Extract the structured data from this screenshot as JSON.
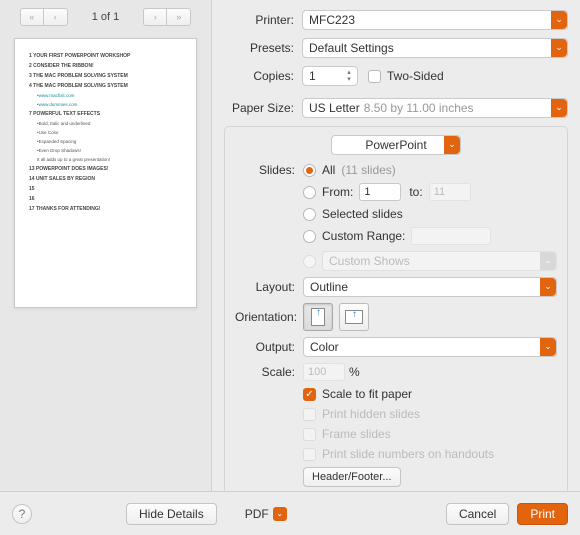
{
  "pager": {
    "label": "1 of 1"
  },
  "printer": {
    "label": "Printer:",
    "value": "MFC223"
  },
  "presets": {
    "label": "Presets:",
    "value": "Default Settings"
  },
  "copies": {
    "label": "Copies:",
    "value": "1",
    "two_sided_label": "Two-Sided"
  },
  "paper": {
    "label": "Paper Size:",
    "value": "US Letter",
    "dim": "8.50 by 11.00 inches"
  },
  "app": {
    "name": "PowerPoint"
  },
  "slides": {
    "label": "Slides:",
    "all": "All",
    "all_count": "(11 slides)",
    "from_label": "From:",
    "from_v": "1",
    "to_label": "to:",
    "to_v": "11",
    "selected": "Selected slides",
    "custom": "Custom Range:",
    "shows_label": "Custom Shows"
  },
  "layout": {
    "label": "Layout:",
    "value": "Outline"
  },
  "orientation": {
    "label": "Orientation:"
  },
  "output": {
    "label": "Output:",
    "value": "Color"
  },
  "scale": {
    "label": "Scale:",
    "value": "100",
    "pct": "%"
  },
  "checks": {
    "fit": "Scale to fit paper",
    "hidden": "Print hidden slides",
    "frame": "Frame slides",
    "numbers": "Print slide numbers on handouts"
  },
  "header_footer": "Header/Footer...",
  "footer": {
    "help": "?",
    "hide": "Hide Details",
    "pdf": "PDF",
    "cancel": "Cancel",
    "print": "Print"
  },
  "preview": {
    "items": [
      {
        "t": "YOUR FIRST POWERPOINT WORKSHOP",
        "b": true
      },
      {
        "t": "CONSIDER THE RIBBON!",
        "b": true
      },
      {
        "t": "THE MAC PROBLEM SOLVING SYSTEM",
        "b": true
      },
      {
        "t": "THE MAC PROBLEM SOLVING SYSTEM",
        "b": true
      },
      {
        "t": "•www.macfixit.com",
        "link": true
      },
      {
        "t": "•www.dummies.com",
        "link": true
      },
      {
        "t": "POWERFUL TEXT EFFECTS",
        "b": true
      },
      {
        "t": "•Bold, Italic and underlined",
        "sub": true
      },
      {
        "t": "•Use Color",
        "sub": true
      },
      {
        "t": "•Expanded  Spacing",
        "sub": true
      },
      {
        "t": "•Even Drop Shadows!",
        "sub": true
      },
      {
        "t": "It all adds up to a great presentation!",
        "sub": true
      },
      {
        "t": "POWERPOINT DOES IMAGES!",
        "b": true
      },
      {
        "t": "UNIT SALES BY REGION",
        "b": true
      },
      {
        "t": "",
        "b": true
      },
      {
        "t": "",
        "b": true
      },
      {
        "t": "THANKS FOR ATTENDING!",
        "b": true
      }
    ]
  }
}
